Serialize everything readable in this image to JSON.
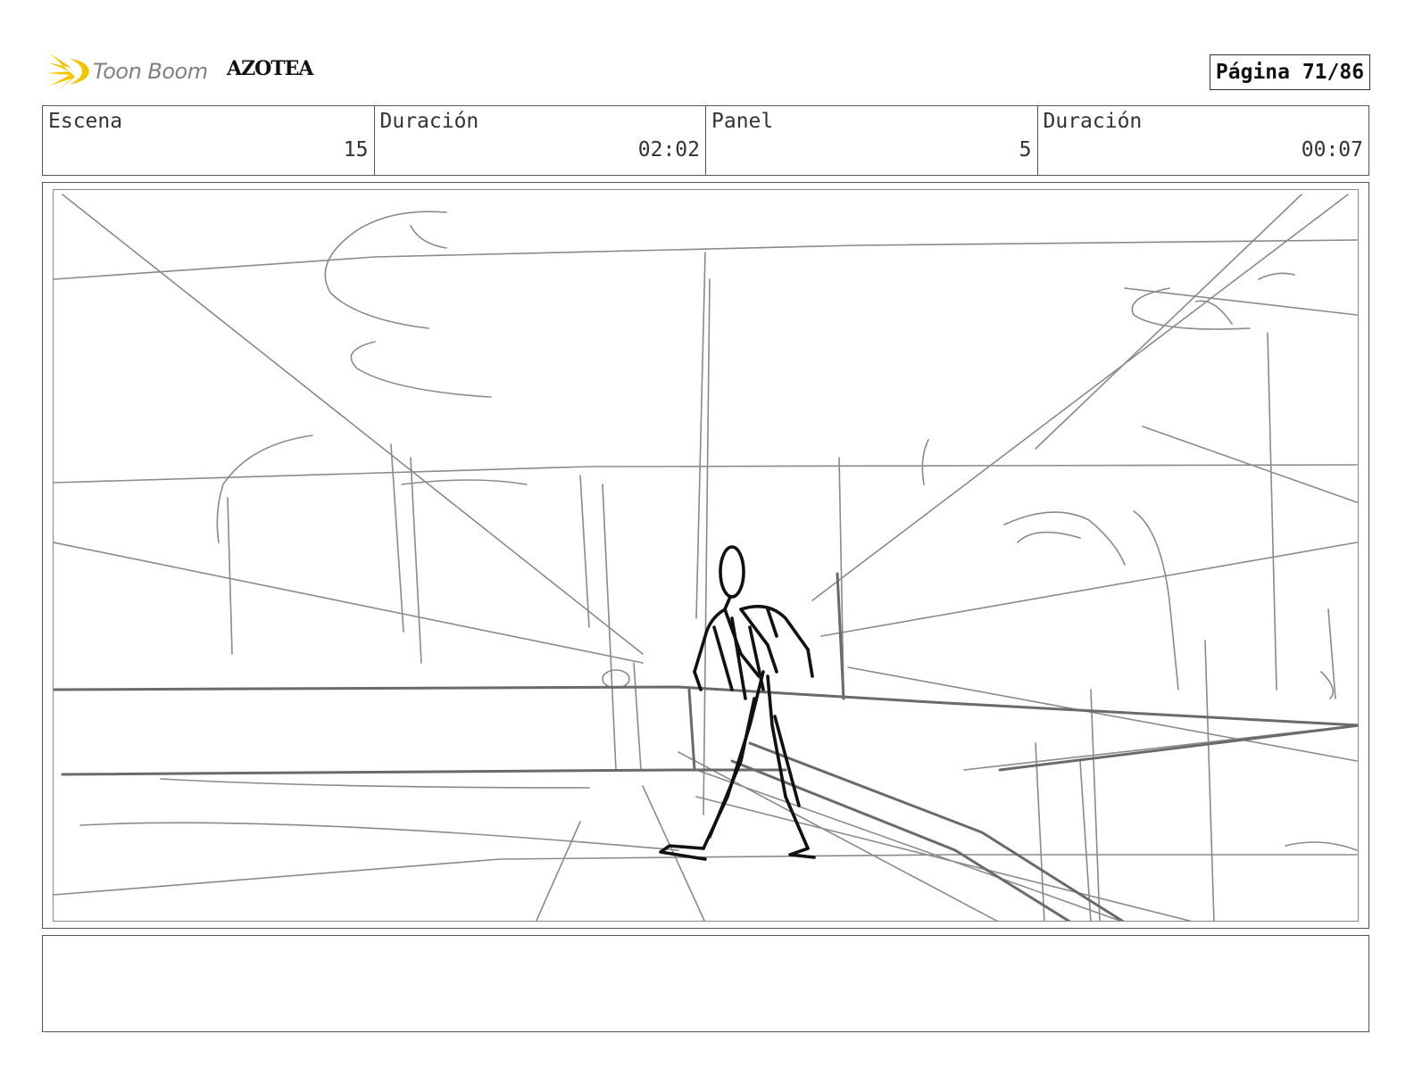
{
  "header": {
    "logo_text": "Toon Boom",
    "project_title": "AZOTEA",
    "page_label": "Página 71/86"
  },
  "info": {
    "scene_label": "Escena",
    "scene_value": "15",
    "scene_duration_label": "Duración",
    "scene_duration_value": "02:02",
    "panel_label": "Panel",
    "panel_value": "5",
    "panel_duration_label": "Duración",
    "panel_duration_value": "00:07"
  },
  "notes": {
    "text": ""
  },
  "colors": {
    "logo_accent": "#F5C400",
    "sketch_light": "#8a8a8a",
    "sketch_dark": "#111111"
  }
}
